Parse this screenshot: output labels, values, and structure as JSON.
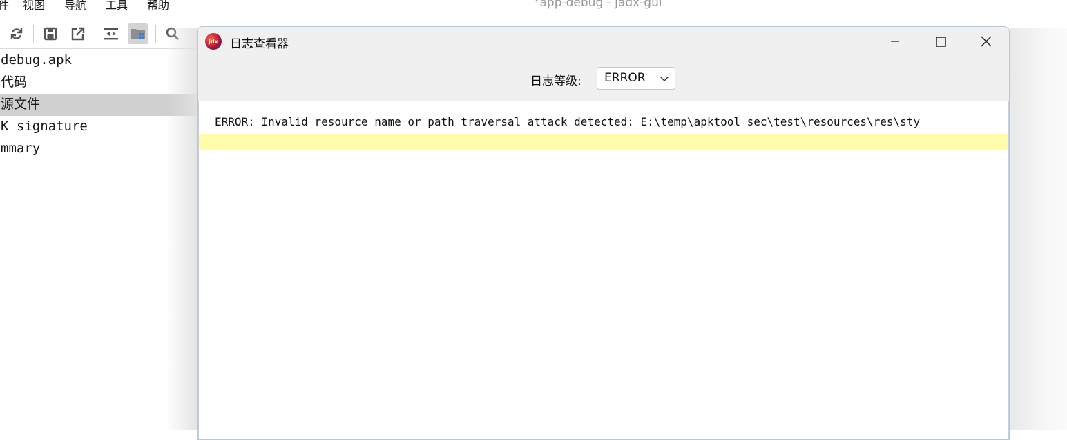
{
  "window": {
    "title": "*app-debug - jadx-gui"
  },
  "menu": [
    {
      "label": "件"
    },
    {
      "label": "视图"
    },
    {
      "label": "导航"
    },
    {
      "label": "工具"
    },
    {
      "label": "帮助"
    }
  ],
  "toolbar": {
    "icons": [
      "refresh-icon",
      "save-icon",
      "export-icon",
      "sync-icon",
      "flatten-packages-icon",
      "search-icon"
    ]
  },
  "tree": {
    "items": [
      {
        "label": "debug.apk"
      },
      {
        "label": "代码"
      },
      {
        "label": "源文件"
      },
      {
        "label": "K signature"
      },
      {
        "label": "mmary"
      }
    ],
    "selected_index": 2
  },
  "dialog": {
    "title": "日志查看器",
    "level_label": "日志等级:",
    "level_value": "ERROR",
    "log_text": "ERROR: Invalid resource name or path traversal attack detected: E:\\temp\\apktool sec\\test\\resources\\res\\sty"
  },
  "colors": {
    "selection": "#d0d0d0",
    "log_highlight": "#fffdaa",
    "dialog_bg": "#f0f0f0"
  }
}
